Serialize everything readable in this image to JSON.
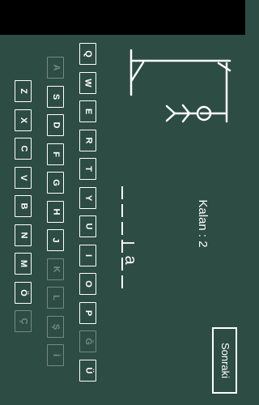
{
  "keyboard": {
    "rows": [
      {
        "keys": [
          {
            "label": "Q",
            "used": false
          },
          {
            "label": "W",
            "used": false
          },
          {
            "label": "E",
            "used": false
          },
          {
            "label": "R",
            "used": false
          },
          {
            "label": "T",
            "used": false
          },
          {
            "label": "Y",
            "used": false
          },
          {
            "label": "U",
            "used": false
          },
          {
            "label": "I",
            "used": false
          },
          {
            "label": "O",
            "used": false
          },
          {
            "label": "P",
            "used": false
          },
          {
            "label": "Ğ",
            "used": true
          },
          {
            "label": "Ü",
            "used": false
          }
        ]
      },
      {
        "keys": [
          {
            "label": "A",
            "used": true
          },
          {
            "label": "S",
            "used": false
          },
          {
            "label": "D",
            "used": false
          },
          {
            "label": "F",
            "used": false
          },
          {
            "label": "G",
            "used": false
          },
          {
            "label": "H",
            "used": false
          },
          {
            "label": "J",
            "used": false
          },
          {
            "label": "K",
            "used": true
          },
          {
            "label": "L",
            "used": true
          },
          {
            "label": "Ş",
            "used": true
          },
          {
            "label": "İ",
            "used": true
          }
        ]
      },
      {
        "keys": [
          {
            "label": "Z",
            "used": false
          },
          {
            "label": "X",
            "used": false
          },
          {
            "label": "C",
            "used": false
          },
          {
            "label": "V",
            "used": false
          },
          {
            "label": "B",
            "used": false
          },
          {
            "label": "N",
            "used": false
          },
          {
            "label": "M",
            "used": false
          },
          {
            "label": "Ö",
            "used": false
          },
          {
            "label": "Ç",
            "used": true
          }
        ]
      }
    ]
  },
  "word": {
    "revealed": [
      "l",
      "a"
    ]
  },
  "status": {
    "remaining": "Kalan : 2"
  },
  "actions": {
    "next_label": "Sonraki"
  },
  "colors": {
    "board": "#2d4c43",
    "chalk": "#ffffff",
    "used_key": "rgba(255,255,255,0.35)"
  }
}
